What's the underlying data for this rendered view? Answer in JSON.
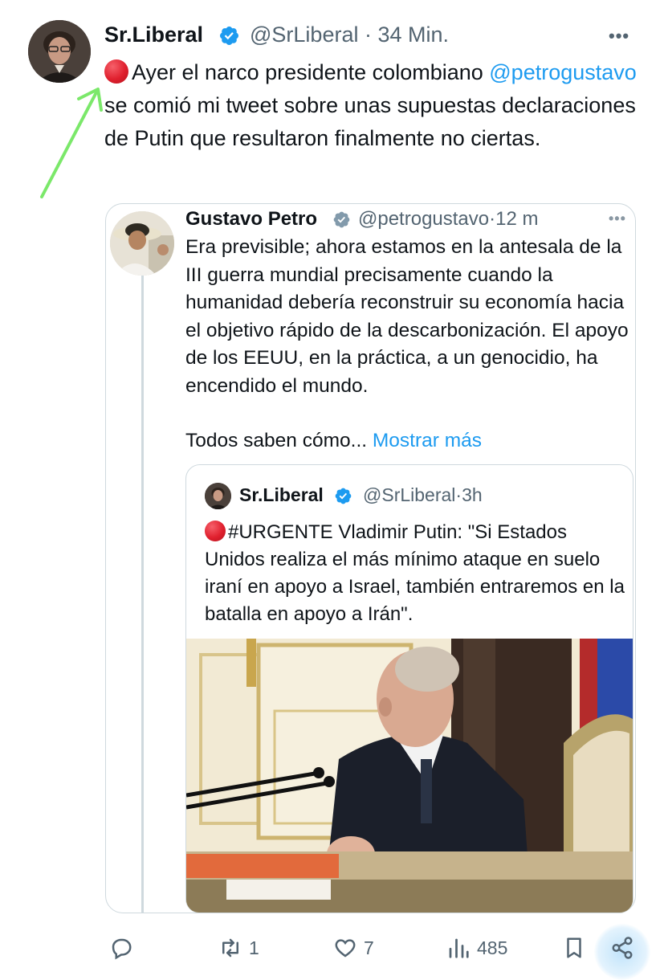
{
  "tweet": {
    "author_name": "Sr.Liberal",
    "handle": "@SrLiberal",
    "time": "34 Min.",
    "text_part1": "Ayer el narco presidente colombiano ",
    "mention": "@petrogustavo",
    "text_part2": " se comió mi tweet sobre unas supuestas declaraciones de Putin que resultaron finalmente no ciertas."
  },
  "quoted_tweet": {
    "author_name": "Gustavo Petro",
    "handle": "@petrogustavo",
    "time": "12 m",
    "text": "Era previsible; ahora estamos en la antesala de la III guerra mundial precisamente cuando la humanidad debería reconstruir su economía hacia el objetivo rápido de la descarbonización. El apoyo de los EEUU, en la práctica, a un genocidio, ha encendido el mundo.",
    "text_more": "Todos saben cómo...",
    "show_more_label": "Mostrar más"
  },
  "nested_quote": {
    "author_name": "Sr.Liberal",
    "handle": "@SrLiberal",
    "time": "3h",
    "text": "#URGENTE Vladimir Putin:  \"Si Estados Unidos realiza el más mínimo ataque en suelo iraní en apoyo a Israel, también entraremos en la batalla en apoyo a Irán\"."
  },
  "actions": {
    "replies": "",
    "retweets": "1",
    "likes": "7",
    "views": "485"
  },
  "separator": "·",
  "colors": {
    "accent": "#1d9bf0",
    "text": "#0f1419",
    "muted": "#536471",
    "border": "#cfd9de",
    "annotation_arrow": "#7be86a",
    "red_dot": "#e0202e"
  },
  "icons": [
    "verified-badge-icon",
    "more-icon",
    "red-circle-emoji",
    "reply-icon",
    "retweet-icon",
    "like-icon",
    "views-icon",
    "bookmark-icon",
    "share-icon"
  ]
}
